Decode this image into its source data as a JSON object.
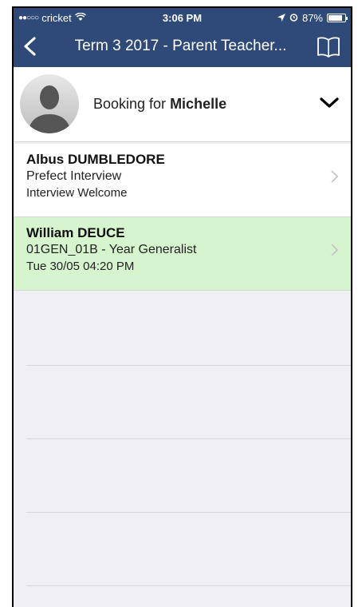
{
  "status_bar": {
    "carrier": "cricket",
    "time": "3:06 PM",
    "battery": "87%",
    "battery_level": 0.87
  },
  "nav": {
    "title": "Term 3 2017 - Parent Teacher...",
    "back_icon": "chevron-left-icon",
    "book_icon": "book-icon"
  },
  "booking": {
    "prefix": "Booking for ",
    "student": "Michelle"
  },
  "appointments": [
    {
      "name": "Albus DUMBLEDORE",
      "line1": "Prefect Interview",
      "line2": "Interview Welcome",
      "highlight": false
    },
    {
      "name": "William DEUCE",
      "line1": "01GEN_01B - Year  Generalist",
      "line2": "Tue 30/05 04:20 PM",
      "highlight": true
    }
  ],
  "colors": {
    "nav_bg": "#2f4a78",
    "highlight_row": "#d6f5cf",
    "list_bg": "#efeff4"
  }
}
